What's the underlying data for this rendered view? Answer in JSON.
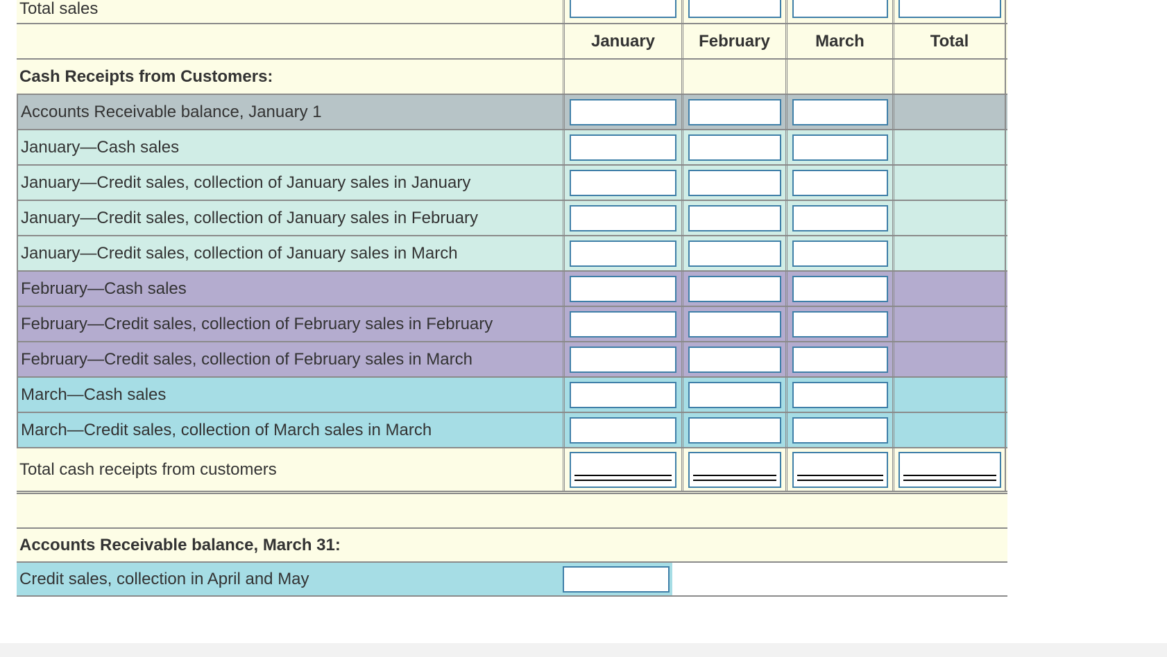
{
  "header_columns": [
    "January",
    "February",
    "March",
    "Total"
  ],
  "rows": {
    "total_sales": "Total sales",
    "cash_receipts_heading": "Cash Receipts from Customers:",
    "ar_jan1": "Accounts Receivable balance, January 1",
    "jan_cash": "January—Cash sales",
    "jan_credit_jan": "January—Credit sales, collection of January sales in January",
    "jan_credit_feb": "January—Credit sales, collection of January sales in February",
    "jan_credit_mar": "January—Credit sales, collection of January sales in March",
    "feb_cash": "February—Cash sales",
    "feb_credit_feb": "February—Credit sales, collection of February sales in February",
    "feb_credit_mar": "February—Credit sales, collection of February sales in March",
    "mar_cash": "March—Cash sales",
    "mar_credit_mar": "March—Credit sales, collection of March sales in March",
    "total_cash_receipts": "Total cash receipts from customers",
    "ar_mar31_heading": "Accounts Receivable balance, March 31:",
    "credit_apr_may": "Credit sales, collection in April and May"
  },
  "colors": {
    "yellow": "#fdfde6",
    "gray": "#b7c4c7",
    "mint": "#d0ede6",
    "purple": "#b4accf",
    "cyan": "#a6dde5",
    "input_border": "#3f7fa8"
  }
}
